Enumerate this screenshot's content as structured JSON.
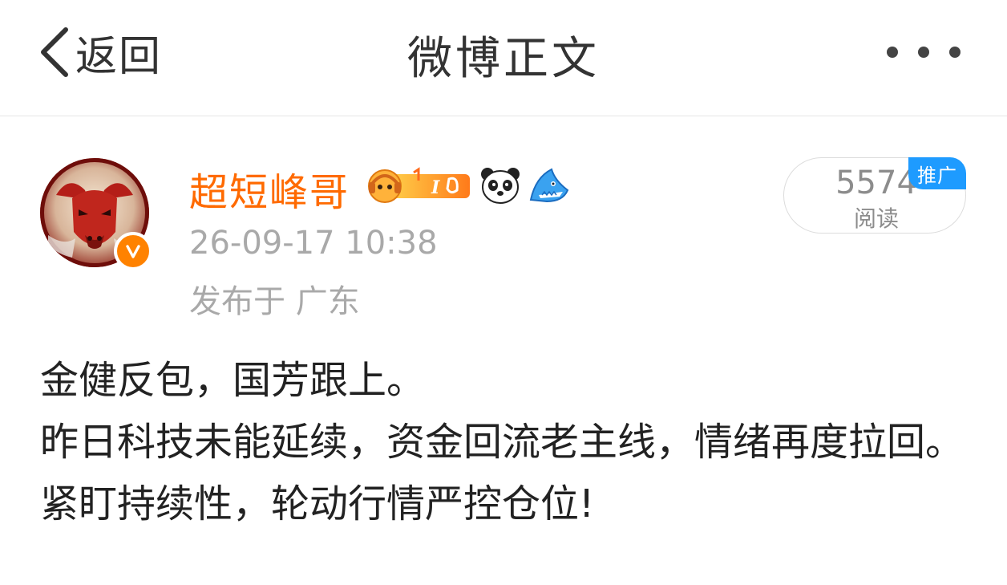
{
  "header": {
    "back_label": "返回",
    "title": "微博正文",
    "back_icon": "chevron-left-icon",
    "more_icon": "more-dots-icon"
  },
  "author": {
    "name": "超短峰哥",
    "verified_icon": "verified-v-icon",
    "badges": [
      "music-badge-icon",
      "panda-icon",
      "shark-icon"
    ],
    "timestamp": "26-09-17 10:38",
    "location": "发布于 广东",
    "name_color": "#ff6a00"
  },
  "stats": {
    "read_count": "5574",
    "read_label": "阅读",
    "promo_label": "推广",
    "promo_color": "#1e9bff"
  },
  "post": {
    "lines": [
      "金健反包，国芳跟上。",
      "昨日科技未能延续，资金回流老主线，情绪再度拉回。",
      "紧盯持续性，轮动行情严控仓位!"
    ]
  }
}
